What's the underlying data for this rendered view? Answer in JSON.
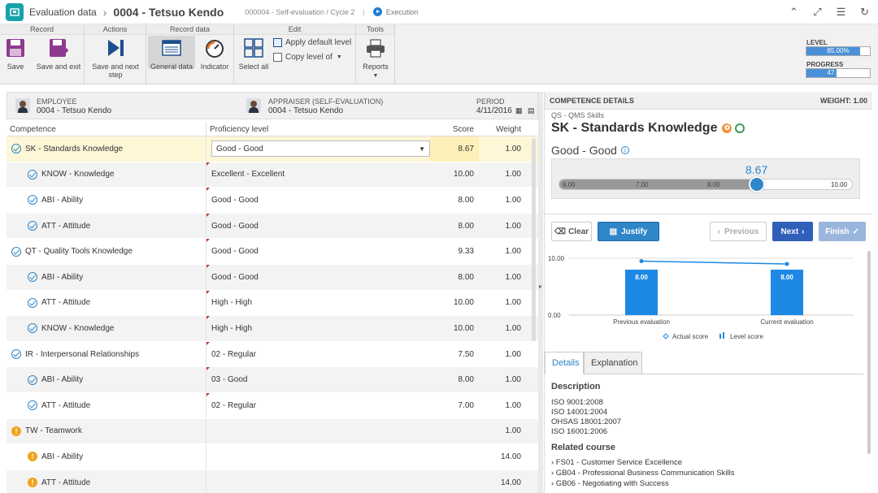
{
  "topbar": {
    "title": "Evaluation data",
    "record": "0004 - Tetsuo Kendo",
    "subtitle": "000004 - Self-evaluation / Cycle 2",
    "separator": "|",
    "status": "Execution"
  },
  "ribbon": {
    "groups": {
      "record": "Record",
      "actions": "Actions",
      "record_data": "Record data",
      "edit": "Edit",
      "tools": "Tools"
    },
    "save": "Save",
    "save_exit": "Save and exit",
    "save_next_1": "Save and next",
    "save_next_2": "step",
    "general_data": "General data",
    "indicator": "Indicator",
    "select_all": "Select all",
    "apply_default": "Apply default level",
    "copy_level": "Copy level of",
    "reports": "Reports",
    "level_label": "LEVEL",
    "level_value": "85.00%",
    "level_fraction": 0.85,
    "progress_label": "PROGRESS",
    "progress_value": "47.33%",
    "progress_fraction": 0.4733
  },
  "header": {
    "employee_label": "EMPLOYEE",
    "employee_value": "0004 - Tetsuo Kendo",
    "appraiser_label": "APPRAISER (SELF-EVALUATION)",
    "appraiser_value": "0004 - Tetsuo Kendo",
    "period_label": "PERIOD",
    "period_value": "4/11/2016"
  },
  "table": {
    "columns": [
      "Competence",
      "Proficiency level",
      "Score",
      "Weight"
    ],
    "rows": [
      {
        "competence": "SK - Standards Knowledge",
        "level": "Good - Good",
        "score": "8.67",
        "weight": "1.00"
      },
      {
        "competence": "KNOW - Knowledge",
        "level": "Excellent - Excellent",
        "score": "10.00",
        "weight": "1.00"
      },
      {
        "competence": "ABI - Ability",
        "level": "Good - Good",
        "score": "8.00",
        "weight": "1.00"
      },
      {
        "competence": "ATT - Attitude",
        "level": "Good - Good",
        "score": "8.00",
        "weight": "1.00"
      },
      {
        "competence": "QT - Quality Tools Knowledge",
        "level": "Good - Good",
        "score": "9.33",
        "weight": "1.00"
      },
      {
        "competence": "ABI - Ability",
        "level": "Good - Good",
        "score": "8.00",
        "weight": "1.00"
      },
      {
        "competence": "ATT - Attitude",
        "level": "High - High",
        "score": "10.00",
        "weight": "1.00"
      },
      {
        "competence": "KNOW - Knowledge",
        "level": "High - High",
        "score": "10.00",
        "weight": "1.00"
      },
      {
        "competence": "IR - Interpersonal Relationships",
        "level": "02 - Regular",
        "score": "7.50",
        "weight": "1.00"
      },
      {
        "competence": "ABI - Ability",
        "level": "03 - Good",
        "score": "8.00",
        "weight": "1.00"
      },
      {
        "competence": "ATT - Attitude",
        "level": "02 - Regular",
        "score": "7.00",
        "weight": "1.00"
      },
      {
        "competence": "TW - Teamwork",
        "level": "",
        "score": "",
        "weight": "1.00"
      },
      {
        "competence": "ABI - Ability",
        "level": "",
        "score": "",
        "weight": "14.00"
      },
      {
        "competence": "ATT - Attitude",
        "level": "",
        "score": "",
        "weight": "14.00"
      }
    ]
  },
  "details": {
    "header": "COMPETENCE DETAILS",
    "weight": "WEIGHT: 1.00",
    "group": "QS - QMS Skills",
    "title": "SK - Standards Knowledge",
    "level": "Good - Good",
    "slider_value": "8.67",
    "slider_ticks": [
      "6.00",
      "7.00",
      "8.00",
      "10.00"
    ],
    "clear": "Clear",
    "justify": "Justify",
    "previous": "Previous",
    "next": "Next",
    "finish": "Finish",
    "tab_details": "Details",
    "tab_explanation": "Explanation",
    "description_title": "Description",
    "description_lines": [
      "ISO 9001:2008",
      "ISO 14001:2004",
      "OHSAS 18001:2007",
      "ISO 16001:2006"
    ],
    "course_title": "Related course",
    "courses": [
      "› FS01 - Customer Service Excellence",
      "› GB04 - Professional Business Communication Skills",
      "› GB06 - Negotiating with Success"
    ]
  },
  "chart_data": {
    "type": "bar",
    "categories": [
      "Previous evaluation",
      "Current evaluation"
    ],
    "series": [
      {
        "name": "Actual score",
        "values": [
          9.5,
          9.0
        ]
      },
      {
        "name": "Level score",
        "values": [
          8.0,
          8.0
        ]
      }
    ],
    "data_labels": [
      "8.00",
      "8.00"
    ],
    "y_ticks": [
      "10.00",
      "0.00"
    ],
    "ylim": [
      0,
      10
    ],
    "legend_position": "bottom",
    "colors": {
      "bars": "#1e88e5",
      "line": "#1e88e5"
    }
  }
}
